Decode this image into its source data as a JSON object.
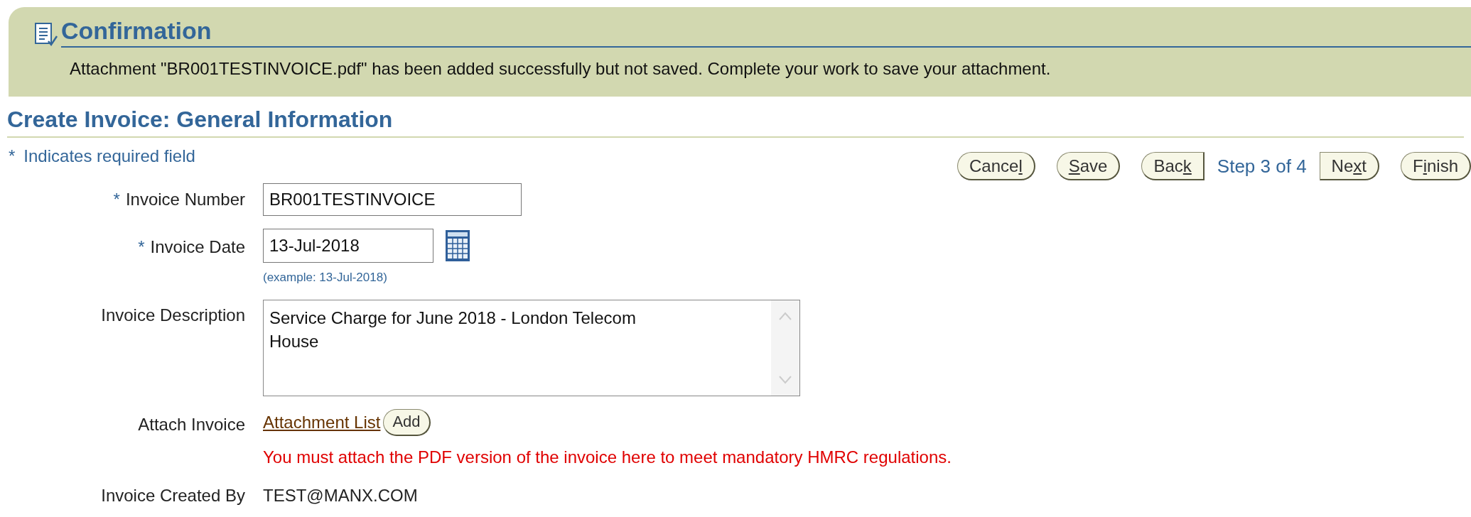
{
  "confirmation": {
    "title": "Confirmation",
    "message": "Attachment \"BR001TESTINVOICE.pdf\" has been added successfully but not saved. Complete your work to save your attachment."
  },
  "page": {
    "title": "Create Invoice: General Information",
    "required_note": "Indicates required field",
    "required_mark": "*"
  },
  "buttons": [
    {
      "kind": "pill",
      "before": "Cance",
      "key": "l"
    },
    {
      "kind": "pill",
      "key": "S",
      "after": "ave"
    },
    {
      "kind": "train_back",
      "before": "Bac",
      "key": "k"
    },
    {
      "kind": "step",
      "text": "Step 3 of 4"
    },
    {
      "kind": "train_next",
      "before": "Ne",
      "key": "x",
      "after": "t"
    },
    {
      "kind": "pill",
      "before": "F",
      "key": "i",
      "after": "nish"
    }
  ],
  "fields": [
    {
      "kind": "text",
      "label": "Invoice Number",
      "required": true,
      "value": "BR001TESTINVOICE"
    },
    {
      "kind": "date",
      "label": "Invoice Date",
      "required": true,
      "value": "13-Jul-2018",
      "hint": "(example: 13-Jul-2018)"
    },
    {
      "kind": "textarea",
      "label": "Invoice Description",
      "required": false,
      "value": "Service Charge for June 2018 - London Telecom House"
    },
    {
      "kind": "attach",
      "label": "Attach Invoice",
      "required": false,
      "link": "Attachment List",
      "button": "Add",
      "error": "You must attach the PDF version of the invoice here to meet mandatory HMRC regulations."
    },
    {
      "kind": "readonly",
      "label": "Invoice Created By",
      "required": false,
      "value": "TEST@MANX.COM"
    }
  ]
}
